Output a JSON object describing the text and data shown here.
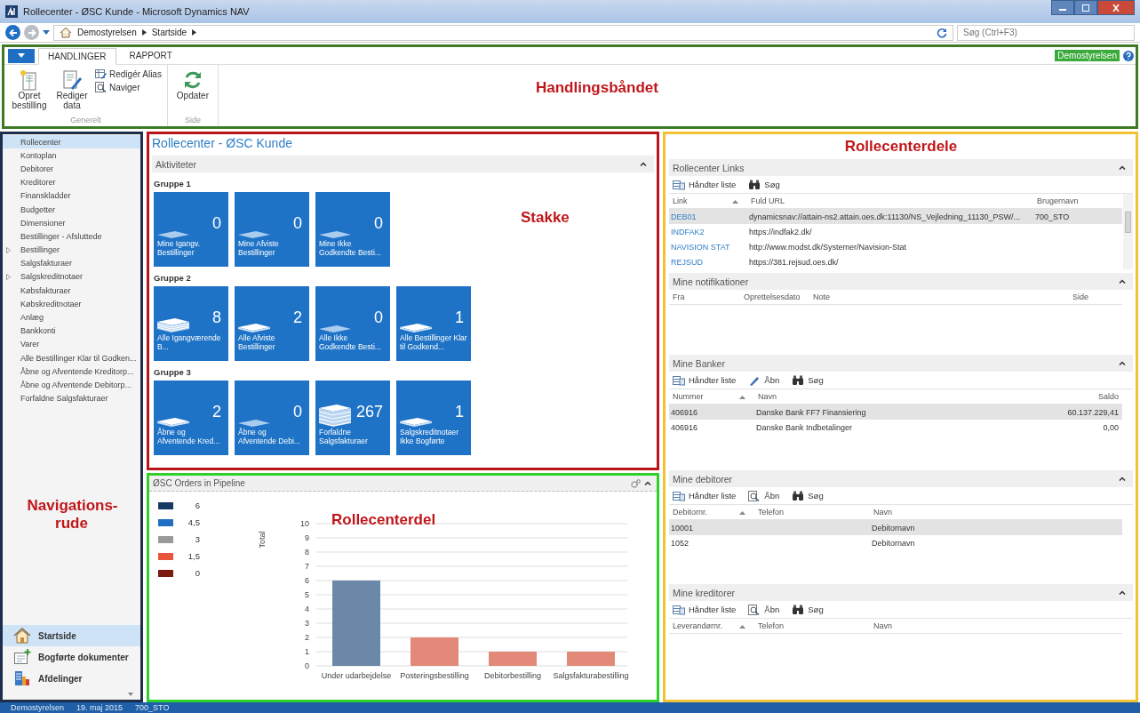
{
  "window": {
    "title": "Rollecenter - ØSC Kunde - Microsoft Dynamics NAV"
  },
  "address_bar": {
    "breadcrumb": [
      "Demostyrelsen",
      "Startside"
    ],
    "search": {
      "placeholder": "Søg (Ctrl+F3)"
    }
  },
  "ribbon": {
    "tabs": [
      {
        "label": "HANDLINGER",
        "selected": true
      },
      {
        "label": "RAPPORT",
        "selected": false
      }
    ],
    "company": "Demostyrelsen",
    "groups": [
      {
        "title": "Generelt",
        "large": [
          {
            "label": "Opret bestilling"
          },
          {
            "label": "Rediger data"
          }
        ],
        "small": [
          {
            "label": "Redigér Alias"
          },
          {
            "label": "Naviger"
          }
        ]
      },
      {
        "title": "Side",
        "large": [
          {
            "label": "Opdater"
          }
        ]
      }
    ],
    "annotation": "Handlingsbåndet"
  },
  "navigation": {
    "items": [
      {
        "label": "Rollecenter",
        "selected": true,
        "expandable": false
      },
      {
        "label": "Kontoplan",
        "selected": false,
        "expandable": false
      },
      {
        "label": "Debitorer",
        "selected": false,
        "expandable": false
      },
      {
        "label": "Kreditorer",
        "selected": false,
        "expandable": false
      },
      {
        "label": "Finanskladder",
        "selected": false,
        "expandable": false
      },
      {
        "label": "Budgetter",
        "selected": false,
        "expandable": false
      },
      {
        "label": "Dimensioner",
        "selected": false,
        "expandable": false
      },
      {
        "label": "Bestillinger - Afsluttede",
        "selected": false,
        "expandable": false
      },
      {
        "label": "Bestillinger",
        "selected": false,
        "expandable": true
      },
      {
        "label": "Salgsfakturaer",
        "selected": false,
        "expandable": false
      },
      {
        "label": "Salgskreditnotaer",
        "selected": false,
        "expandable": true
      },
      {
        "label": "Købsfakturaer",
        "selected": false,
        "expandable": false
      },
      {
        "label": "Købskreditnotaer",
        "selected": false,
        "expandable": false
      },
      {
        "label": "Anlæg",
        "selected": false,
        "expandable": false
      },
      {
        "label": "Bankkonti",
        "selected": false,
        "expandable": false
      },
      {
        "label": "Varer",
        "selected": false,
        "expandable": false
      },
      {
        "label": "Alle Bestillinger Klar til Godken...",
        "selected": false,
        "expandable": false
      },
      {
        "label": "Åbne og Afventende Kreditorp...",
        "selected": false,
        "expandable": false
      },
      {
        "label": "Åbne og Afventende Debitorp...",
        "selected": false,
        "expandable": false
      },
      {
        "label": "Forfaldne Salgsfakturaer",
        "selected": false,
        "expandable": false
      }
    ],
    "annotation": "Navigations-rude",
    "buttons": [
      {
        "label": "Startside",
        "selected": true
      },
      {
        "label": "Bogførte dokumenter",
        "selected": false
      },
      {
        "label": "Afdelinger",
        "selected": false
      }
    ]
  },
  "activities": {
    "page_title": "Rollecenter - ØSC Kunde",
    "title": "Aktiviteter",
    "annotation": "Stakke",
    "groups": [
      {
        "title": "Gruppe 1",
        "tiles": [
          {
            "label": "Mine Igangv. Bestillinger",
            "count": "0"
          },
          {
            "label": "Mine Afviste Bestillinger",
            "count": "0"
          },
          {
            "label": "Mine Ikke Godkendte Besti...",
            "count": "0"
          }
        ]
      },
      {
        "title": "Gruppe 2",
        "tiles": [
          {
            "label": "Alle Igangværende B...",
            "count": "8"
          },
          {
            "label": "Alle Afviste Bestillinger",
            "count": "2"
          },
          {
            "label": "Alle Ikke Godkendte Besti...",
            "count": "0"
          },
          {
            "label": "Alle Bestillinger Klar til Godkend...",
            "count": "1"
          }
        ]
      },
      {
        "title": "Gruppe 3",
        "tiles": [
          {
            "label": "Åbne og Afventende Kred...",
            "count": "2"
          },
          {
            "label": "Åbne og Afventende Debi...",
            "count": "0"
          },
          {
            "label": "Forfaldne Salgsfakturaer",
            "count": "267"
          },
          {
            "label": "Salgskreditnotaer Ikke Bogførte",
            "count": "1"
          }
        ]
      }
    ]
  },
  "chart_part": {
    "title": "ØSC Orders in Pipeline",
    "annotation": "Rollecenterdel",
    "legend": [
      {
        "label": "6",
        "color": "#173a63"
      },
      {
        "label": "4,5",
        "color": "#1f6fc2"
      },
      {
        "label": "3",
        "color": "#9a9a9a"
      },
      {
        "label": "1,5",
        "color": "#e8553a"
      },
      {
        "label": "0",
        "color": "#7a1a10"
      }
    ],
    "chart_data": {
      "type": "bar",
      "ylabel": "Total",
      "categories": [
        "Under udarbejdelse",
        "Posteringsbestilling",
        "Debitorbestilling",
        "Salgsfakturabestilling"
      ],
      "series": [
        {
          "color": "#6c88a8",
          "values": [
            6,
            null,
            null,
            null
          ]
        },
        {
          "color": "#e2897a",
          "values": [
            null,
            2,
            1,
            1
          ]
        }
      ],
      "grid": true,
      "ylim": [
        0,
        10
      ],
      "yticks": [
        0,
        1,
        2,
        3,
        4,
        5,
        6,
        7,
        8,
        9,
        10
      ]
    }
  },
  "parts_annotation": "Rollecenterdele",
  "parts": [
    {
      "title": "Rollecenter Links",
      "actions": [
        {
          "label": "Håndter liste",
          "kind": "manage"
        },
        {
          "label": "Søg",
          "kind": "search"
        }
      ],
      "columns": [
        {
          "label": "Link",
          "sorted": true,
          "kind": "link"
        },
        {
          "label": "Fuld URL",
          "sorted": false,
          "kind": "text"
        },
        {
          "label": "Brugernavn",
          "sorted": false,
          "kind": "text"
        }
      ],
      "rows": [
        {
          "selected": true,
          "cells": [
            "DEB01",
            "dynamicsnav://attain-ns2.attain.oes.dk:11130/NS_Vejledning_11130_PSW/...",
            "700_STO"
          ]
        },
        {
          "selected": false,
          "cells": [
            "INDFAK2",
            "https://indfak2.dk/",
            null
          ]
        },
        {
          "selected": false,
          "cells": [
            "NAVISION STAT",
            "http://www.modst.dk/Systemer/Navision-Stat",
            null
          ]
        },
        {
          "selected": false,
          "cells": [
            "REJSUD",
            "https://381.rejsud.oes.dk/",
            null
          ]
        }
      ]
    },
    {
      "title": "Mine notifikationer",
      "columns": [
        {
          "label": "Fra",
          "kind": "text"
        },
        {
          "label": "Oprettelsesdato",
          "kind": "text"
        },
        {
          "label": "Note",
          "kind": "text"
        },
        {
          "label": "Side",
          "kind": "text"
        }
      ]
    },
    {
      "title": "Mine Banker",
      "actions": [
        {
          "label": "Håndter liste",
          "kind": "manage"
        },
        {
          "label": "Åbn",
          "kind": "edit"
        },
        {
          "label": "Søg",
          "kind": "search"
        }
      ],
      "columns": [
        {
          "label": "Nummer",
          "sorted": true,
          "kind": "text"
        },
        {
          "label": "Navn",
          "sorted": false,
          "kind": "text"
        },
        {
          "label": "Saldo",
          "sorted": false,
          "kind": "amount"
        }
      ],
      "rows": [
        {
          "selected": true,
          "cells": [
            "406916",
            "Danske Bank FF7  Finansiering",
            "60.137.229,41"
          ]
        },
        {
          "selected": false,
          "cells": [
            "406916",
            "Danske Bank Indbetalinger",
            "0,00"
          ]
        }
      ]
    },
    {
      "title": "Mine debitorer",
      "actions": [
        {
          "label": "Håndter liste",
          "kind": "manage"
        },
        {
          "label": "Åbn",
          "kind": "open"
        },
        {
          "label": "Søg",
          "kind": "search"
        }
      ],
      "columns": [
        {
          "label": "Debitornr.",
          "sorted": true,
          "kind": "text"
        },
        {
          "label": "Telefon",
          "sorted": false,
          "kind": "text"
        },
        {
          "label": "Navn",
          "sorted": false,
          "kind": "text"
        }
      ],
      "rows": [
        {
          "selected": true,
          "cells": [
            "10001",
            null,
            "Debitornavn"
          ]
        },
        {
          "selected": false,
          "cells": [
            "1052",
            null,
            "Debitornavn"
          ]
        }
      ]
    },
    {
      "title": "Mine kreditorer",
      "actions": [
        {
          "label": "Håndter liste",
          "kind": "manage"
        },
        {
          "label": "Åbn",
          "kind": "open"
        },
        {
          "label": "Søg",
          "kind": "search"
        }
      ],
      "columns": [
        {
          "label": "Leverandørnr.",
          "sorted": true,
          "kind": "text"
        },
        {
          "label": "Telefon",
          "sorted": false,
          "kind": "text"
        },
        {
          "label": "Navn",
          "sorted": false,
          "kind": "text"
        }
      ]
    }
  ],
  "status_bar": [
    "Demostyrelsen",
    "19. maj 2015",
    "700_STO"
  ]
}
